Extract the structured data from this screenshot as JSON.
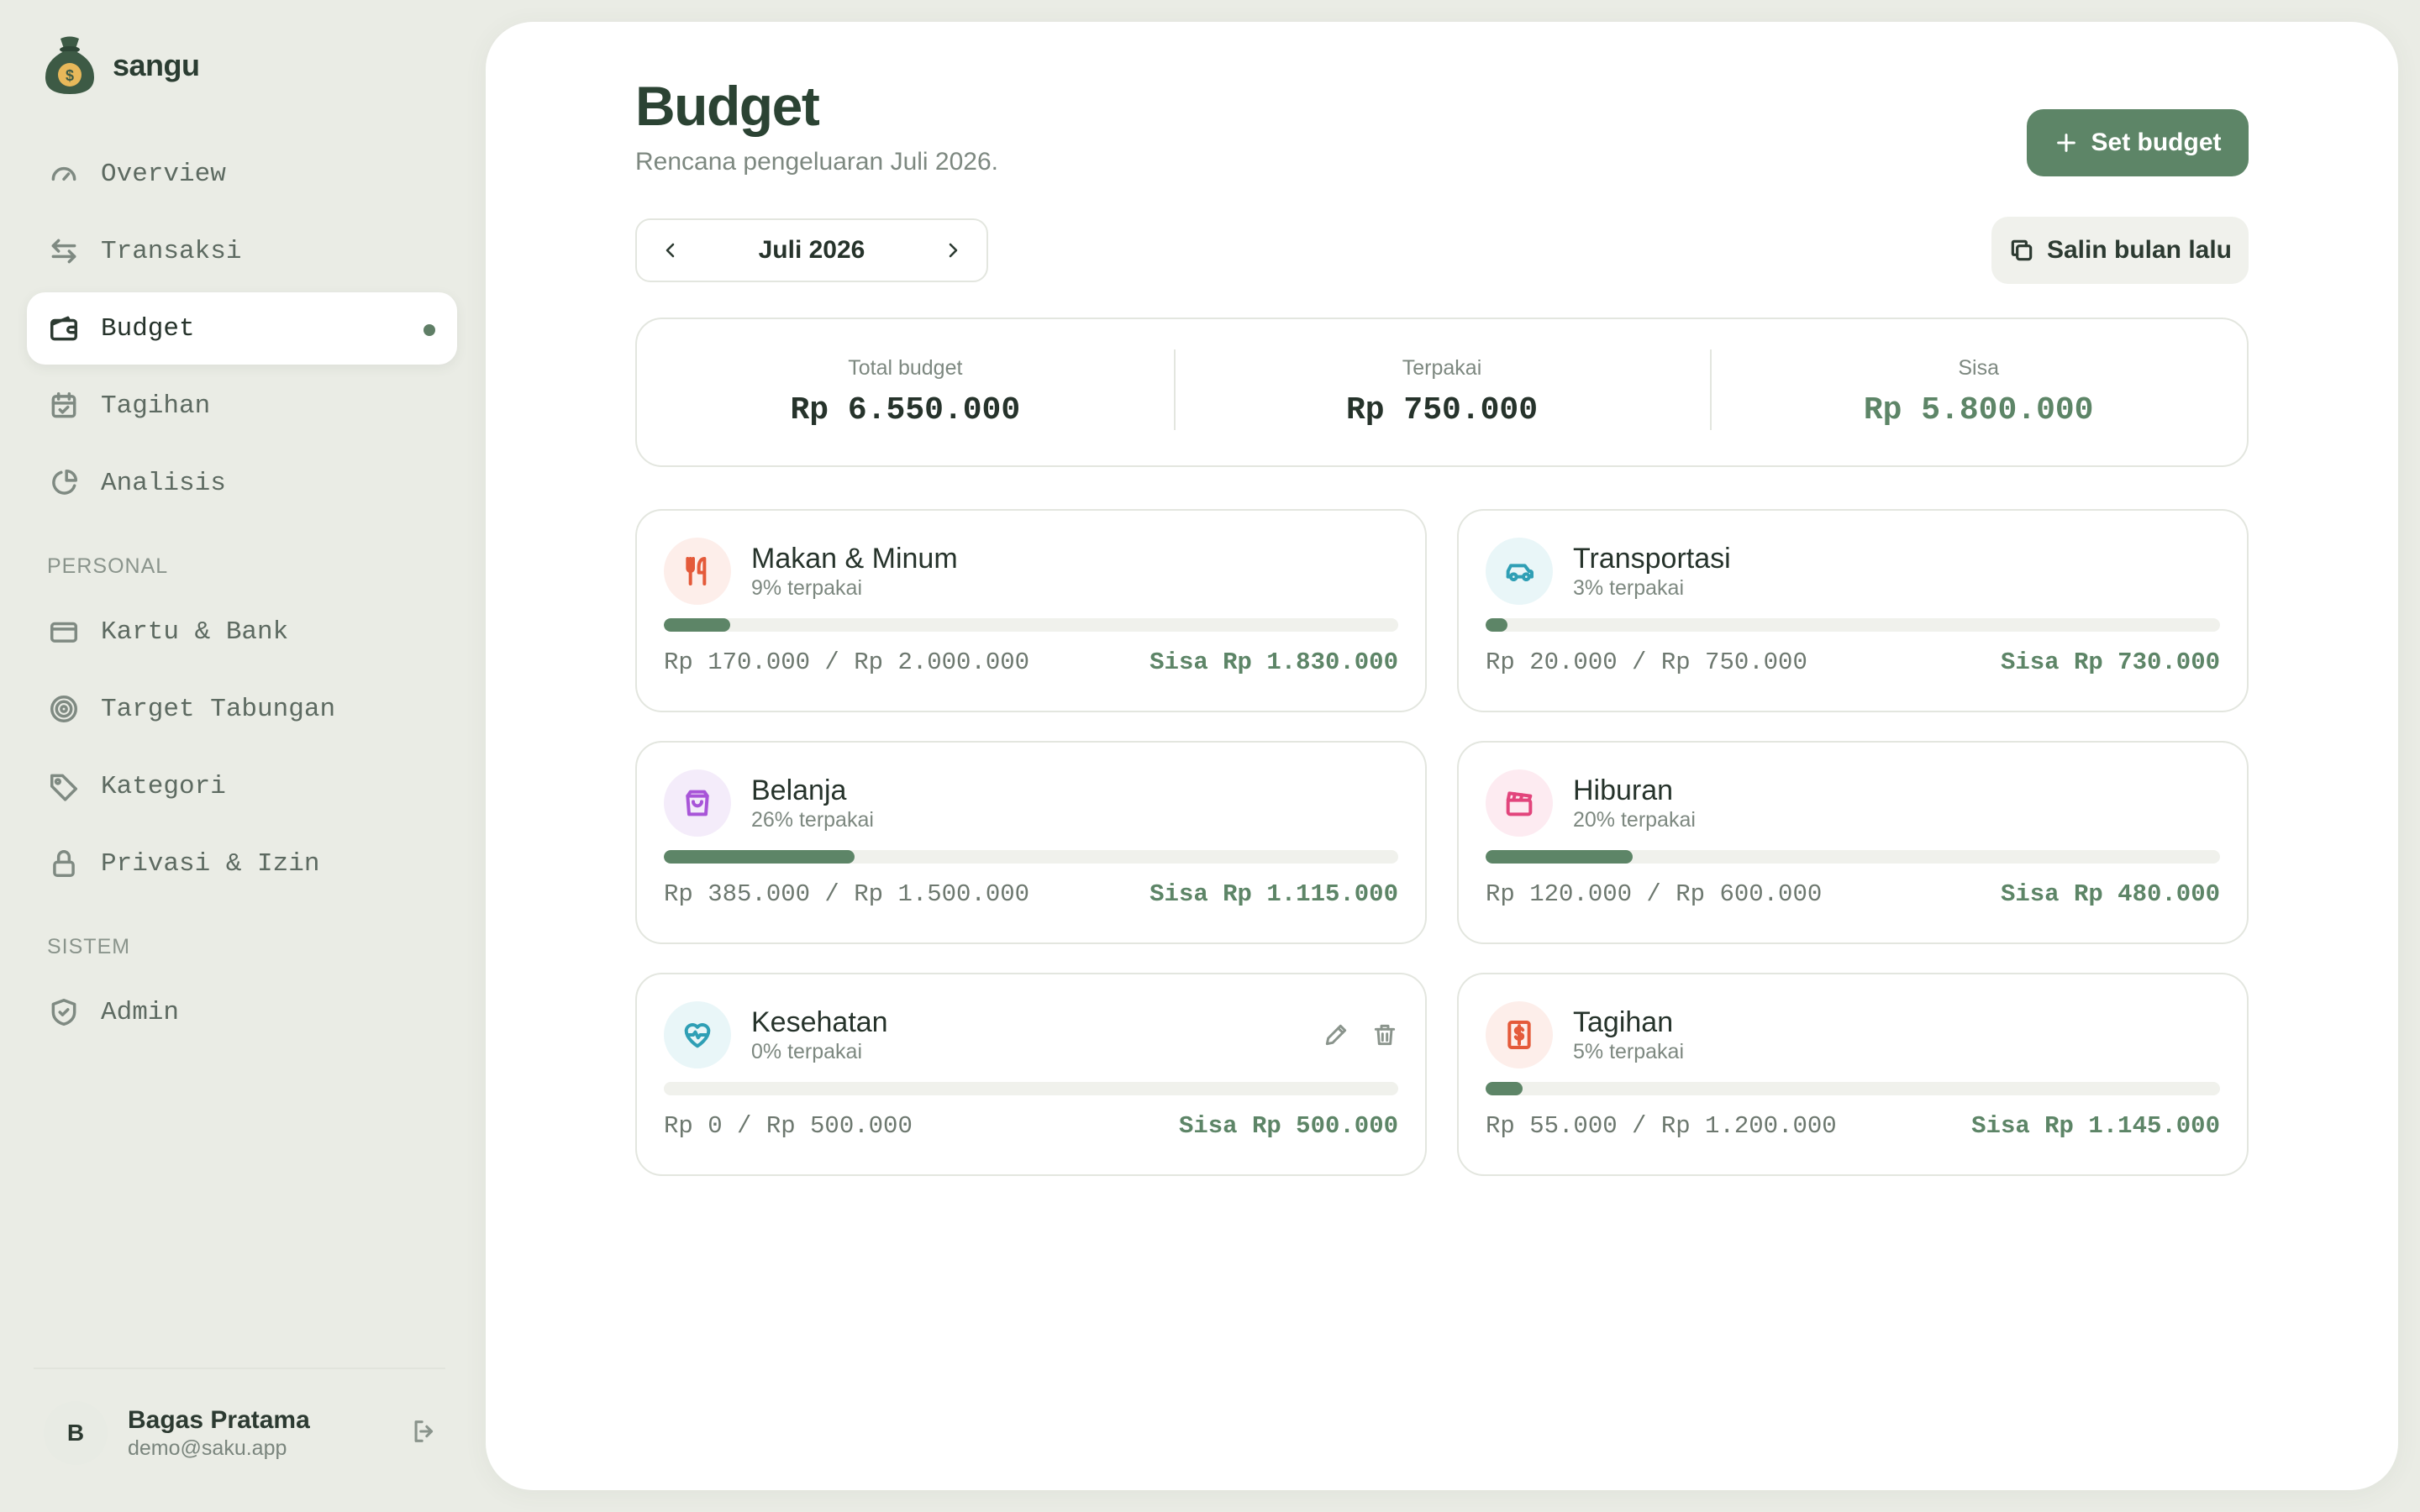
{
  "app": {
    "name": "sangu"
  },
  "nav": {
    "main": [
      {
        "label": "Overview",
        "icon": "gauge-icon"
      },
      {
        "label": "Transaksi",
        "icon": "arrows-swap-icon"
      },
      {
        "label": "Budget",
        "icon": "wallet-icon",
        "active": true
      },
      {
        "label": "Tagihan",
        "icon": "calendar-check-icon"
      },
      {
        "label": "Analisis",
        "icon": "pie-chart-icon"
      }
    ],
    "personal_title": "PERSONAL",
    "personal": [
      {
        "label": "Kartu & Bank",
        "icon": "credit-card-icon"
      },
      {
        "label": "Target Tabungan",
        "icon": "target-icon"
      },
      {
        "label": "Kategori",
        "icon": "tag-icon"
      },
      {
        "label": "Privasi & Izin",
        "icon": "lock-icon"
      }
    ],
    "system_title": "SISTEM",
    "system": [
      {
        "label": "Admin",
        "icon": "shield-check-icon"
      }
    ]
  },
  "user": {
    "initial": "B",
    "name": "Bagas Pratama",
    "email": "demo@saku.app"
  },
  "page": {
    "title": "Budget",
    "subtitle": "Rencana pengeluaran Juli 2026.",
    "set_budget_label": "Set budget",
    "copy_label": "Salin bulan lalu",
    "month": "Juli 2026"
  },
  "summary": {
    "total_label": "Total budget",
    "total_value": "Rp 6.550.000",
    "used_label": "Terpakai",
    "used_value": "Rp 750.000",
    "remaining_label": "Sisa",
    "remaining_value": "Rp 5.800.000"
  },
  "categories": [
    {
      "name": "Makan & Minum",
      "used": "9% terpakai",
      "percent": 9,
      "amount": "Rp 170.000 / Rp 2.000.000",
      "remaining": "Sisa Rp 1.830.000",
      "icon": "utensils-icon",
      "color": "#e45a3a",
      "bg": "#fdeeea"
    },
    {
      "name": "Transportasi",
      "used": "3% terpakai",
      "percent": 3,
      "amount": "Rp 20.000 / Rp 750.000",
      "remaining": "Sisa Rp 730.000",
      "icon": "car-icon",
      "color": "#2f9fb5",
      "bg": "#e9f6f8"
    },
    {
      "name": "Belanja",
      "used": "26% terpakai",
      "percent": 26,
      "amount": "Rp 385.000 / Rp 1.500.000",
      "remaining": "Sisa Rp 1.115.000",
      "icon": "shopping-bag-icon",
      "color": "#a855d8",
      "bg": "#f4ecfa"
    },
    {
      "name": "Hiburan",
      "used": "20% terpakai",
      "percent": 20,
      "amount": "Rp 120.000 / Rp 600.000",
      "remaining": "Sisa Rp 480.000",
      "icon": "clapperboard-icon",
      "color": "#e2457c",
      "bg": "#fdebf1"
    },
    {
      "name": "Kesehatan",
      "used": "0% terpakai",
      "percent": 0,
      "amount": "Rp 0 / Rp 500.000",
      "remaining": "Sisa Rp 500.000",
      "icon": "heart-pulse-icon",
      "color": "#2f9fb5",
      "bg": "#e9f6f8",
      "show_actions": true
    },
    {
      "name": "Tagihan",
      "used": "5% terpakai",
      "percent": 5,
      "amount": "Rp 55.000 / Rp 1.200.000",
      "remaining": "Sisa Rp 1.145.000",
      "icon": "receipt-icon",
      "color": "#e45a3a",
      "bg": "#fdeeea"
    }
  ],
  "colors": {
    "accent": "#5d8567",
    "background": "#eaece5"
  }
}
